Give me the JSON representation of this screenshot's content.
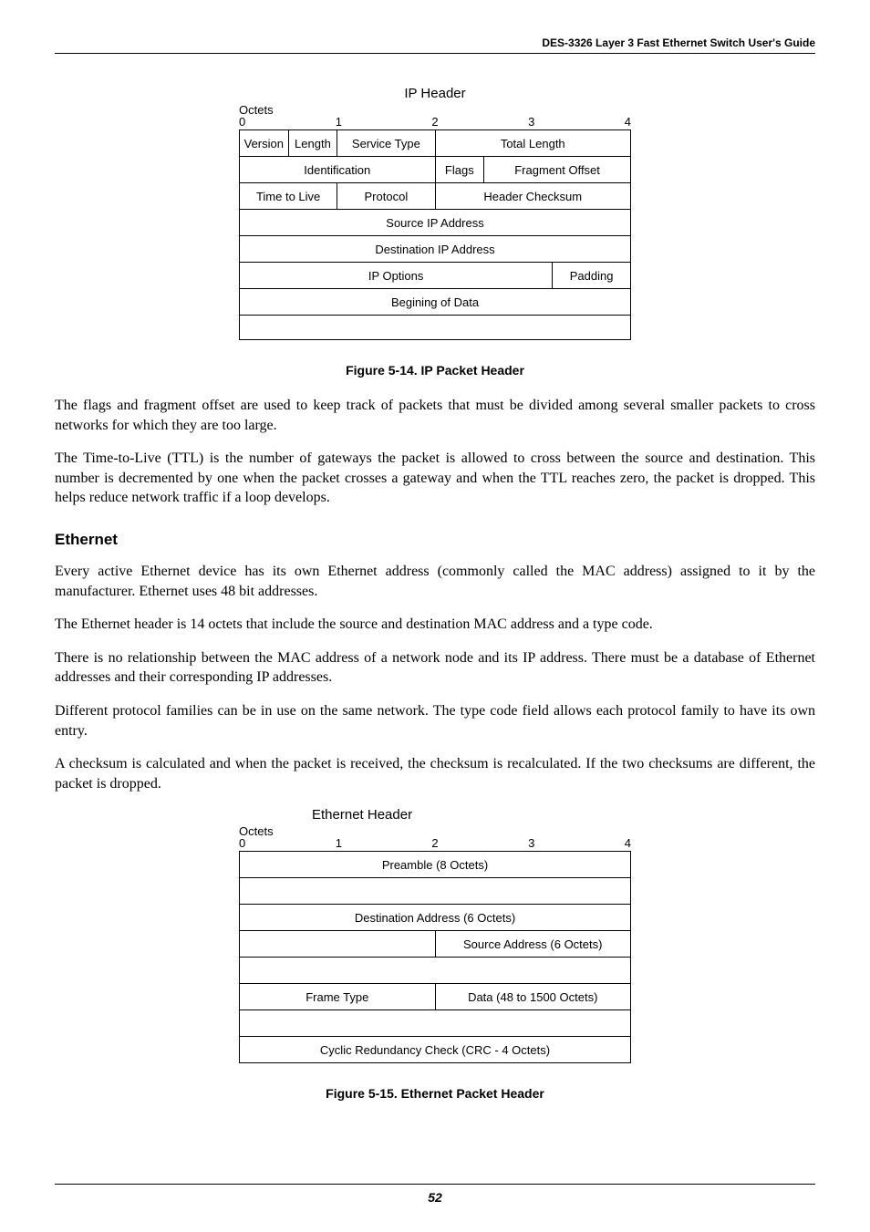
{
  "header": {
    "product": "DES-3326 Layer 3 Fast Ethernet Switch User's Guide"
  },
  "ip_diagram": {
    "title": "IP Header",
    "octets_label": "Octets",
    "nums": [
      "0",
      "1",
      "2",
      "3",
      "4"
    ],
    "r1": {
      "version": "Version",
      "length": "Length",
      "service": "Service Type",
      "total": "Total Length"
    },
    "r2": {
      "ident": "Identification",
      "flags": "Flags",
      "frag": "Fragment Offset"
    },
    "r3": {
      "ttl": "Time to Live",
      "proto": "Protocol",
      "chk": "Header Checksum"
    },
    "r4": "Source IP Address",
    "r5": "Destination IP Address",
    "r6": {
      "opts": "IP Options",
      "pad": "Padding"
    },
    "r7": "Begining of Data"
  },
  "caption1": "Figure 5-14. IP Packet Header",
  "para1": "The flags and fragment offset are used to keep track of packets that must be divided among several smaller packets to cross networks for which they are too large.",
  "para2": "The Time-to-Live (TTL) is the number of gateways the packet is allowed to cross between the source and destination. This number is decremented by one when the packet crosses a gateway and when the TTL reaches zero, the packet is dropped. This helps reduce network traffic if a loop develops.",
  "section": "Ethernet",
  "para3": "Every active Ethernet device has its own Ethernet address (commonly called the MAC address) assigned to it by the manufacturer.  Ethernet uses 48 bit addresses.",
  "para4": "The Ethernet header is 14 octets that include the source and destination MAC address and a type code.",
  "para5": "There is no relationship between the MAC address of a network node and its IP address. There must be a database of Ethernet addresses and their corresponding IP addresses.",
  "para6": "Different protocol families can be in use on the same network. The type code field allows each protocol family to have its own entry.",
  "para7": "A checksum is calculated and when the packet is received, the checksum is recalculated. If the two checksums are different, the packet is dropped.",
  "eth_diagram": {
    "title": "Ethernet Header",
    "octets_label": "Octets",
    "nums": [
      "0",
      "1",
      "2",
      "3",
      "4"
    ],
    "preamble": "Preamble (8 Octets)",
    "dest": "Destination Address (6 Octets)",
    "src": "Source Address (6 Octets)",
    "frame": "Frame Type",
    "data": "Data (48 to 1500 Octets)",
    "crc": "Cyclic Redundancy Check (CRC - 4 Octets)"
  },
  "caption2": "Figure 5-15. Ethernet Packet Header",
  "pagenum": "52"
}
